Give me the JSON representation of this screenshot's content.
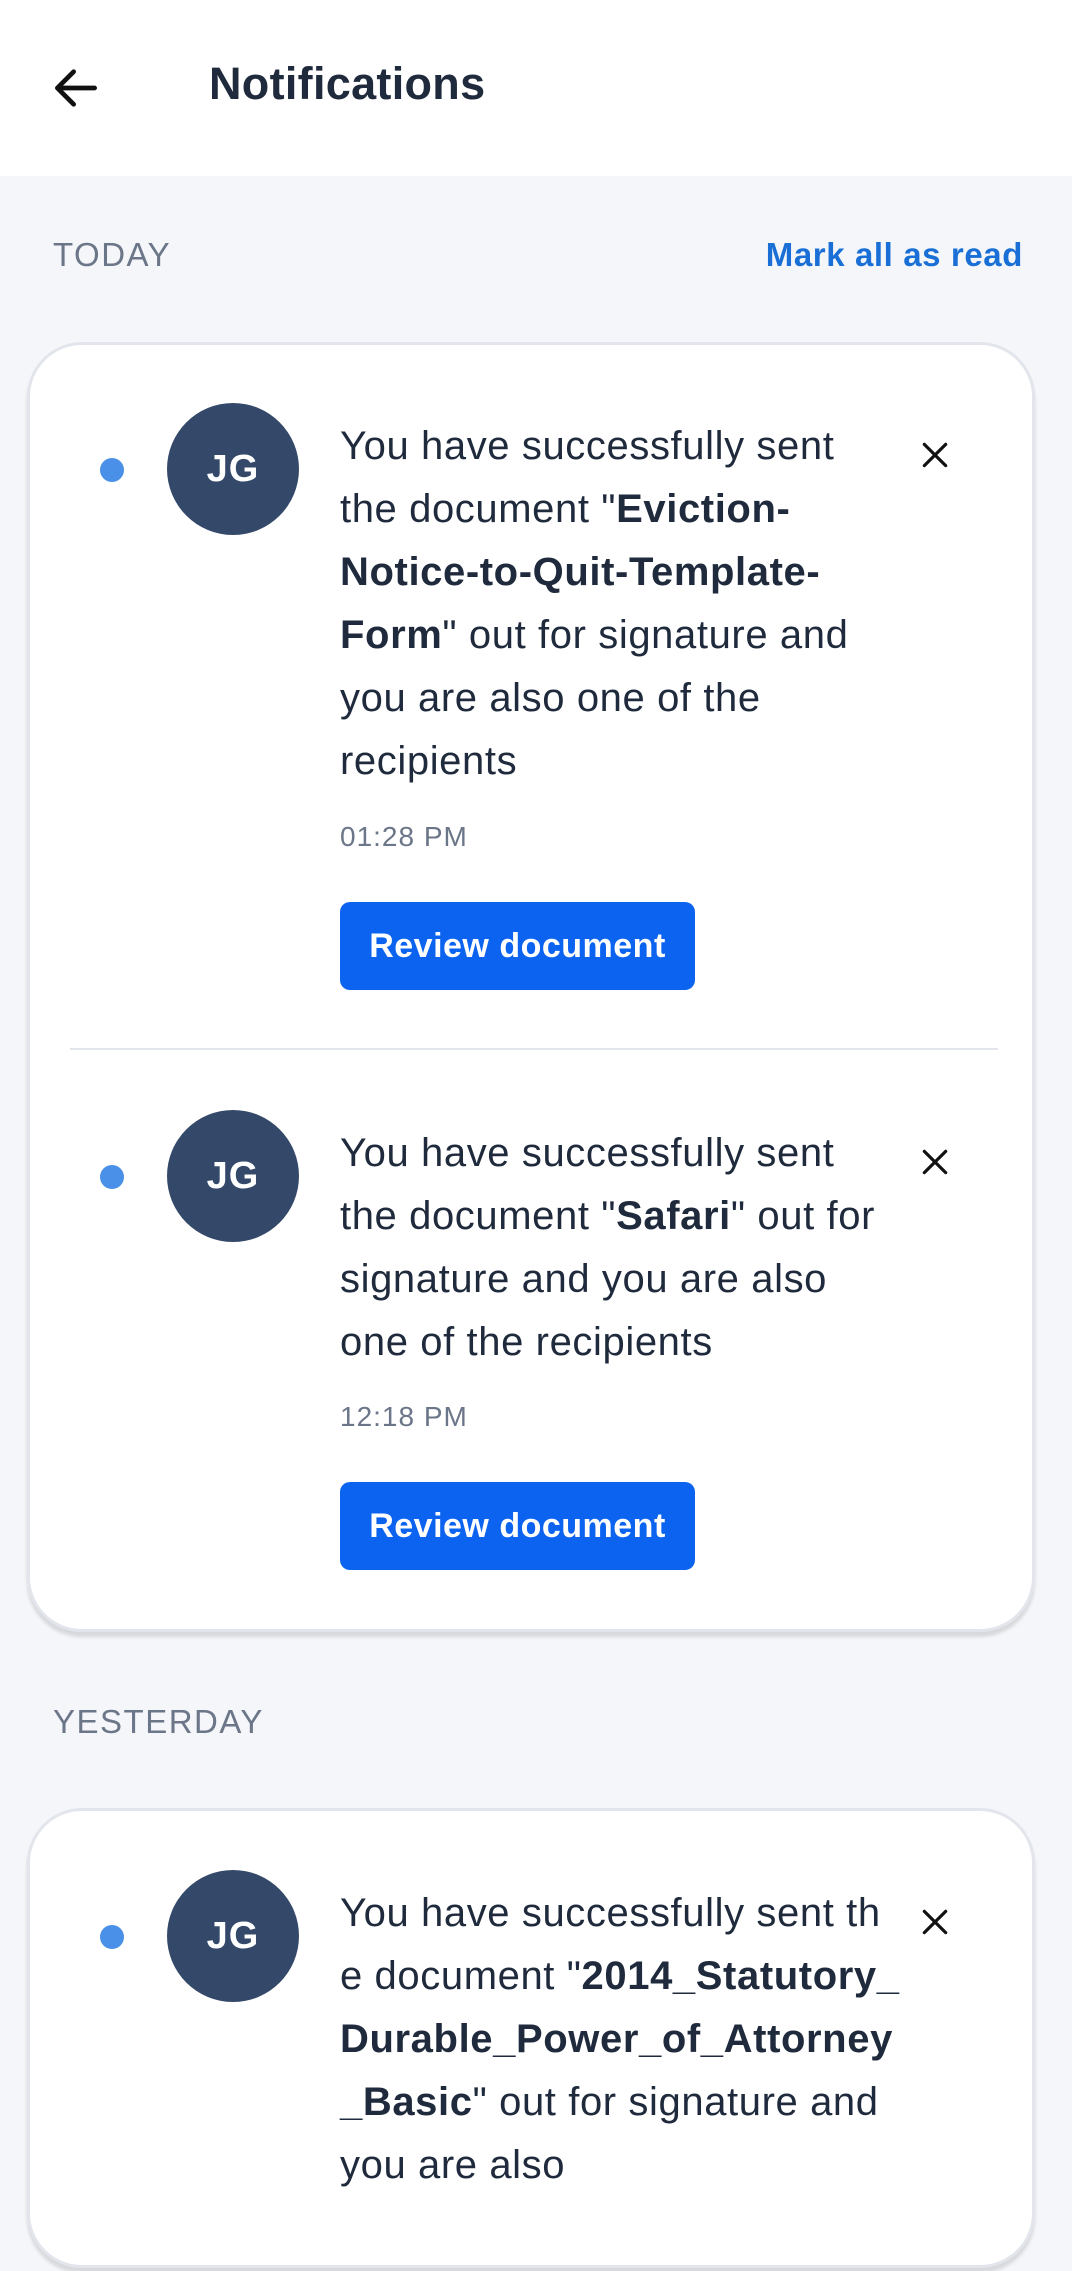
{
  "header": {
    "title": "Notifications",
    "back_icon": "arrow-left-icon"
  },
  "sections": [
    {
      "label": "TODAY",
      "action_label": "Mark all as read",
      "notifications": [
        {
          "avatar_initials": "JG",
          "message_prefix": "You have successfully sent the document \"",
          "document_name": "Eviction-Notice-to-Quit-Template-Form",
          "message_suffix": "\" out for signature and you are also one of the recipients",
          "time": "01:28 PM",
          "button_label": "Review document",
          "unread": true
        },
        {
          "avatar_initials": "JG",
          "message_prefix": "You have successfully sent the document \"",
          "document_name": "Safari",
          "message_suffix": "\" out for signature and you are also one of the recipients",
          "time": "12:18 PM",
          "button_label": "Review document",
          "unread": true
        }
      ]
    },
    {
      "label": "YESTERDAY",
      "notifications": [
        {
          "avatar_initials": "JG",
          "message_prefix": "You have successfully sent the document \"",
          "document_name": "2014_Statutory_Durable_Power_of_Attorney_Basic",
          "message_suffix": "\" out for signature and you are also",
          "unread": true
        }
      ]
    }
  ],
  "colors": {
    "accent": "#0b63f0",
    "link": "#1a6fd6",
    "unread_dot": "#4a8fe8",
    "avatar_bg": "#34496a",
    "page_bg": "#f4f6fa"
  }
}
